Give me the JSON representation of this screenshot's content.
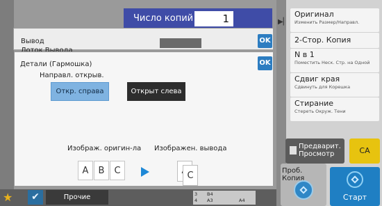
{
  "copies": {
    "label": "Число копий",
    "value": "1"
  },
  "output_dialog": {
    "title": "Вывод",
    "tab": "Лоток Вывода",
    "ok_label": "OK"
  },
  "details_dialog": {
    "title": "Детали (Гармошка)",
    "ok_label": "OK",
    "direction_label": "Направл. открыв.",
    "open_right": "Откр. справа",
    "open_left": "Открыт слева",
    "original_label": "Изображ. оригин-ла",
    "output_label": "Изображен. вывода",
    "original_pages": [
      "A",
      "B",
      "C"
    ],
    "output_pages": [
      "A",
      "C"
    ]
  },
  "right_panel": {
    "items": [
      {
        "title": "Оригинал",
        "subtitle": "Изменить Размер/Направл."
      },
      {
        "title": "2-Стор. Копия",
        "subtitle": ""
      },
      {
        "title": "N в 1",
        "subtitle": "Поместить Неск. Стр. на Одной"
      },
      {
        "title": "Сдвиг края",
        "subtitle": "Сдвинуть для Корешка"
      },
      {
        "title": "Стирание",
        "subtitle": "Стереть Окруж. Тени"
      }
    ],
    "preview_label": "Предварит. Просмотр",
    "ca_label": "CA",
    "proof_label": "Проб. Копия",
    "start_label": "Старт"
  },
  "bottom_bar": {
    "other_label": "Прочие",
    "paper": {
      "r1c1": "3",
      "r1c2": "B4",
      "r2c1": "4",
      "r2c2": "A3",
      "r2c3": "A4"
    }
  },
  "colors": {
    "accent": "#2d7dc1",
    "start": "#1f7fc3",
    "ca": "#e7c30f",
    "copies_bar": "#3f4ca7"
  },
  "icons": [
    "star-icon",
    "check-icon",
    "play-arrow-icon",
    "preview-icon",
    "diamond-icon",
    "collapse-arrow-icon"
  ]
}
